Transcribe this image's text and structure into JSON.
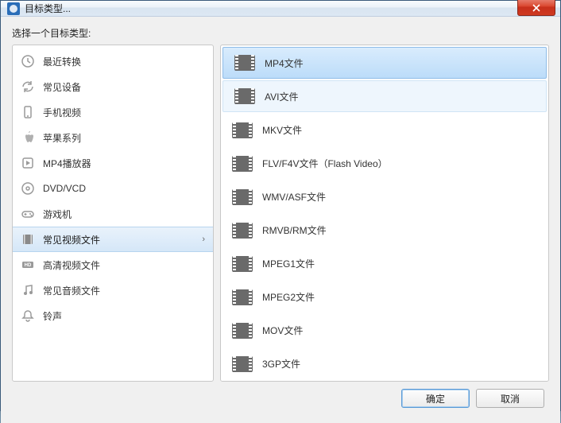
{
  "window": {
    "title": "目标类型..."
  },
  "prompt": "选择一个目标类型:",
  "categories": [
    {
      "label": "最近转换",
      "icon": "clock-icon"
    },
    {
      "label": "常见设备",
      "icon": "refresh-icon"
    },
    {
      "label": "手机视频",
      "icon": "phone-icon"
    },
    {
      "label": "苹果系列",
      "icon": "apple-icon"
    },
    {
      "label": "MP4播放器",
      "icon": "player-icon"
    },
    {
      "label": "DVD/VCD",
      "icon": "disc-icon"
    },
    {
      "label": "游戏机",
      "icon": "gamepad-icon"
    },
    {
      "label": "常见视频文件",
      "icon": "film-icon",
      "selected": true
    },
    {
      "label": "高清视频文件",
      "icon": "hd-icon"
    },
    {
      "label": "常见音频文件",
      "icon": "music-icon"
    },
    {
      "label": "铃声",
      "icon": "bell-icon"
    }
  ],
  "formats": [
    {
      "label": "MP4文件",
      "state": "selected"
    },
    {
      "label": "AVI文件",
      "state": "hover"
    },
    {
      "label": "MKV文件"
    },
    {
      "label": "FLV/F4V文件（Flash Video）"
    },
    {
      "label": "WMV/ASF文件"
    },
    {
      "label": "RMVB/RM文件"
    },
    {
      "label": "MPEG1文件"
    },
    {
      "label": "MPEG2文件"
    },
    {
      "label": "MOV文件"
    },
    {
      "label": "3GP文件"
    }
  ],
  "buttons": {
    "ok": "确定",
    "cancel": "取消"
  }
}
